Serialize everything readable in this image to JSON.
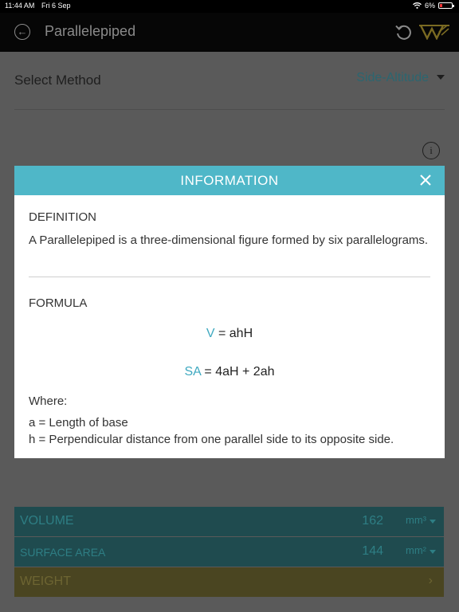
{
  "status_bar": {
    "time": "11:44 AM",
    "date": "Fri 6 Sep",
    "battery": "6%"
  },
  "nav": {
    "title": "Parallelepiped"
  },
  "method": {
    "label": "Select Method",
    "value": "Side-Altitude"
  },
  "results": {
    "volume": {
      "label": "VOLUME",
      "value": "162",
      "unit": "mm³"
    },
    "surface_area": {
      "label": "SURFACE AREA",
      "value": "144",
      "unit": "mm²"
    },
    "weight": {
      "label": "WEIGHT"
    }
  },
  "modal": {
    "title": "INFORMATION",
    "definition_heading": "DEFINITION",
    "definition_text": "A Parallelepiped is a three-dimensional figure formed by six parallelograms.",
    "formula_heading": "FORMULA",
    "formula_volume_symbol": "V",
    "formula_volume_expr": " = ahH",
    "formula_sa_symbol": "SA",
    "formula_sa_expr": " = 4aH + 2ah",
    "where_label": "Where:",
    "definitions": [
      "a = Length of base",
      "h = Perpendicular distance from one parallel side to its opposite side."
    ]
  },
  "colors": {
    "modal_header": "#4fb7c8",
    "accent_symbol": "#3fa9c0",
    "overlay_background": "#5a5a5a",
    "result_teal": "#1f4b4f",
    "result_olive": "#4a4521"
  }
}
